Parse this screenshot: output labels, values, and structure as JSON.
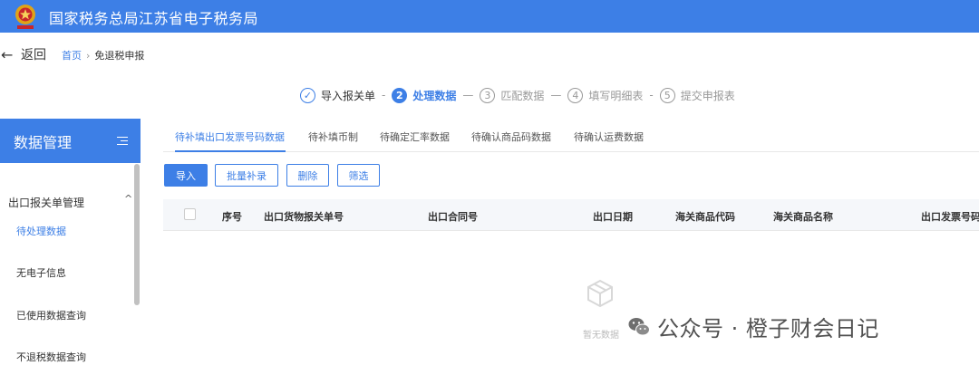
{
  "header": {
    "title": "国家税务总局江苏省电子税务局",
    "logo_icon": "tax-emblem",
    "bg_color": "#3d7fe6"
  },
  "nav": {
    "back_label": "返回",
    "breadcrumb": {
      "home": "首页",
      "separator": "›",
      "current": "免退税申报"
    }
  },
  "steps": [
    {
      "num": "✓",
      "label": "导入报关单",
      "state": "done"
    },
    {
      "num": "2",
      "label": "处理数据",
      "state": "active"
    },
    {
      "num": "3",
      "label": "匹配数据",
      "state": "pending"
    },
    {
      "num": "4",
      "label": "填写明细表",
      "state": "pending"
    },
    {
      "num": "5",
      "label": "提交申报表",
      "state": "pending"
    }
  ],
  "step_separators": [
    "-",
    "—",
    "—",
    "-"
  ],
  "sidebar": {
    "title": "数据管理",
    "group": {
      "label": "出口报关单管理",
      "caret": "^"
    },
    "items": [
      {
        "label": "待处理数据",
        "active": true
      },
      {
        "label": "无电子信息",
        "active": false
      },
      {
        "label": "已使用数据查询",
        "active": false
      },
      {
        "label": "不退税数据查询",
        "active": false
      }
    ]
  },
  "tabs": [
    {
      "label": "待补填出口发票号码数据",
      "active": true
    },
    {
      "label": "待补填币制",
      "active": false
    },
    {
      "label": "待确定汇率数据",
      "active": false
    },
    {
      "label": "待确认商品码数据",
      "active": false
    },
    {
      "label": "待确认运费数据",
      "active": false
    }
  ],
  "toolbar": {
    "import": "导入",
    "batch_fill": "批量补录",
    "delete": "删除",
    "filter": "筛选"
  },
  "table": {
    "columns": [
      "序号",
      "出口货物报关单号",
      "出口合同号",
      "出口日期",
      "海关商品代码",
      "海关商品名称",
      "出口发票号码"
    ],
    "rows": [],
    "empty_text": "暂无数据"
  },
  "watermark": {
    "text": "公众号 · 橙子财会日记",
    "icon": "wechat-icon"
  }
}
